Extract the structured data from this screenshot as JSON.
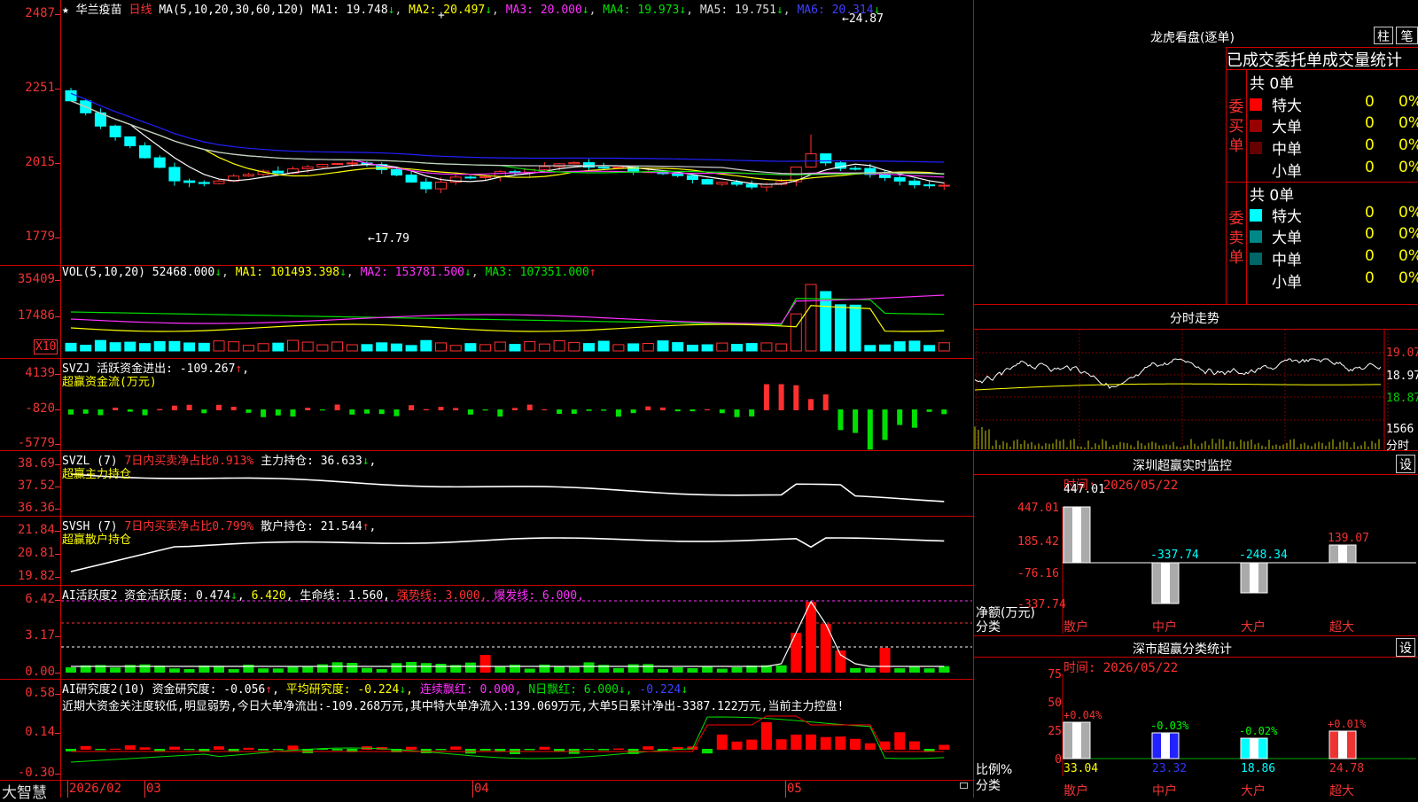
{
  "main": {
    "stock": "华兰疫苗",
    "period": "日线",
    "ma_label": "MA(5,10,20,30,60,120)",
    "ma1": "MA1: 19.748",
    "ma2": "MA2: 20.497",
    "ma3": "MA3: 20.000",
    "ma4": "MA4: 19.973",
    "ma5": "MA5: 19.751",
    "ma6": "MA6: 20.314",
    "hi": "24.87",
    "lo": "17.79",
    "axis": [
      "2487",
      "2251",
      "2015",
      "1779"
    ],
    "arrows": [
      "↓",
      "↓",
      "↓",
      "↓",
      "↓",
      "↓"
    ]
  },
  "vol": {
    "label": "VOL(5,10,20)",
    "v": "52468.000",
    "ma1": "MA1: 101493.398",
    "ma2": "MA2: 153781.500",
    "ma3": "MA3: 107351.000",
    "axis": [
      "35409",
      "17486"
    ],
    "unit": "X10",
    "arrows": [
      "↓",
      "↓",
      "↓",
      "↑"
    ]
  },
  "svzj": {
    "name": "SVZJ",
    "t1": "活跃资金进出: -109.267",
    "arrow": "↑",
    "comma": ",",
    "t2": "超赢资金流(万元)",
    "axis": [
      "4139",
      "-820",
      "-5779"
    ]
  },
  "svzl": {
    "name": "SVZL (7)",
    "t1": "7日内买卖净占比0.913%",
    "t2": "主力持仓: 36.633",
    "arrow": "↓",
    "comma": ",",
    "t3": "超赢主力持仓",
    "axis": [
      "38.69",
      "37.52",
      "36.36"
    ]
  },
  "svsh": {
    "name": "SVSH (7)",
    "t1": "7日内买卖净占比0.799%",
    "t2": "散户持仓: 21.544",
    "arrow": "↑",
    "comma": ",",
    "t3": "超赢散户持仓",
    "axis": [
      "21.84",
      "20.81",
      "19.82"
    ]
  },
  "ai1": {
    "t1": "AI活跃度2 资金活跃度: 0.474",
    "a1": "↓",
    "c1": ",",
    "t2": "6.420",
    "c2": ",",
    "t3": "生命线: 1.560",
    "c3": ",",
    "t4": "强势线: 3.000",
    "c4": ",",
    "t5": "爆发线: 6.000",
    "c5": ",",
    "axis": [
      "6.42",
      "3.17",
      "0.00"
    ]
  },
  "ai2": {
    "t1": "AI研究度2(10) 资金研究度: -0.056",
    "a1": "↑",
    "c1": ",",
    "t2": "平均研究度: -0.224",
    "a2": "↓",
    "c2": ",",
    "t3": "连续飘红: 0.000",
    "c3": ",",
    "t4": "N日飘红: 6.000",
    "a4": "↓",
    "c4": ",",
    "t5": "-0.224",
    "a5": "↓",
    "t6": "近期大资金关注度较低,明显弱势,今日大单净流出:-109.268万元,其中特大单净流入:139.069万元,大单5日累计净出-3387.122万元,当前主力控盘!",
    "axis": [
      "0.58",
      "0.14",
      "-0.30"
    ]
  },
  "bottom": {
    "brand": "大智慧",
    "dates": [
      "2026/02",
      "03",
      "04",
      "05"
    ]
  },
  "longhu": {
    "title": "龙虎看盘(逐单)",
    "btn1": "柱",
    "btn2": "笔",
    "header": "已成交委托单成交量统计",
    "buy": {
      "side": "委买单",
      "total": "共 0单",
      "rows": [
        {
          "name": "特大",
          "v": "0",
          "p": "0%"
        },
        {
          "name": "大单",
          "v": "0",
          "p": "0%"
        },
        {
          "name": "中单",
          "v": "0",
          "p": "0%"
        },
        {
          "name": "小单",
          "v": "0",
          "p": "0%"
        }
      ]
    },
    "sell": {
      "side": "委卖单",
      "total": "共 0单",
      "rows": [
        {
          "name": "特大",
          "v": "0",
          "p": "0%"
        },
        {
          "name": "大单",
          "v": "0",
          "p": "0%"
        },
        {
          "name": "中单",
          "v": "0",
          "p": "0%"
        },
        {
          "name": "小单",
          "v": "0",
          "p": "0%"
        }
      ]
    }
  },
  "fenshi": {
    "title": "分时走势",
    "axis": [
      "19.07",
      "18.97",
      "18.87"
    ],
    "vol": "1566",
    "unit": "分时"
  },
  "monitor": {
    "title": "深圳超赢实时监控",
    "btn": "设",
    "time": "时间: 2026/05/22",
    "axis": [
      "447.01",
      "185.42",
      "-76.16",
      "-337.74"
    ],
    "ylabel1": "净额(万元)",
    "ylabel2": "分类",
    "bars": [
      {
        "cat": "散户",
        "val": "447.01"
      },
      {
        "cat": "中户",
        "val": "-337.74"
      },
      {
        "cat": "大户",
        "val": "-248.34"
      },
      {
        "cat": "超大",
        "val": "139.07"
      }
    ]
  },
  "stats": {
    "title": "深市超赢分类统计",
    "btn": "设",
    "time": "时间: 2026/05/22",
    "axis": [
      "75",
      "50",
      "25",
      "0"
    ],
    "ylabel1": "比例%",
    "ylabel2": "分类",
    "bars": [
      {
        "cat": "散户",
        "chg": "+0.04%",
        "val": "33.04"
      },
      {
        "cat": "中户",
        "chg": "-0.03%",
        "val": "23.32"
      },
      {
        "cat": "大户",
        "chg": "-0.02%",
        "val": "18.86"
      },
      {
        "cat": "超大",
        "chg": "+0.01%",
        "val": "24.78"
      }
    ]
  }
}
